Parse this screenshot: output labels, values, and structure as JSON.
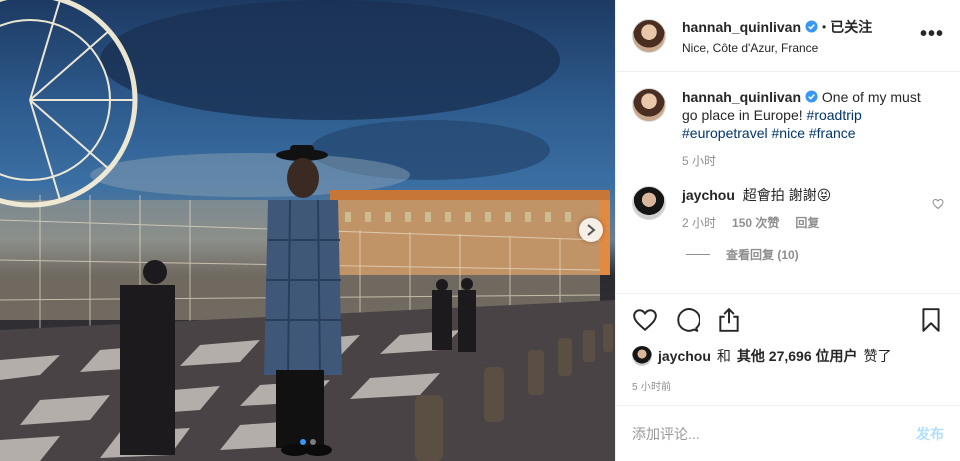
{
  "header": {
    "username": "hannah_quinlivan",
    "separator": "•",
    "follow_status": "已关注",
    "location": "Nice, Côte d'Azur, France",
    "more_label": "•••"
  },
  "caption": {
    "username": "hannah_quinlivan",
    "text": "One of my must go place in Europe!",
    "hashtags": [
      "#roadtrip",
      "#europetravel",
      "#nice",
      "#france"
    ],
    "time": "5 小时"
  },
  "comment": {
    "username": "jaychou",
    "text": "超會拍 謝謝😝",
    "time": "2 小时",
    "likes": "150 次赞",
    "reply_label": "回复",
    "view_replies": "查看回复 (10)"
  },
  "likes": {
    "user": "jaychou",
    "joiner": "和",
    "others_label": "其他 27,696 位用户",
    "suffix": "赞了"
  },
  "post_time": "5 小时前",
  "add_comment": {
    "placeholder": "添加评论...",
    "post_label": "发布"
  },
  "carousel": {
    "total": 2,
    "current": 1
  },
  "colors": {
    "link": "#003569",
    "verified": "#3897f0",
    "post_button": "#b2dffc",
    "muted": "#8e8e8e"
  }
}
